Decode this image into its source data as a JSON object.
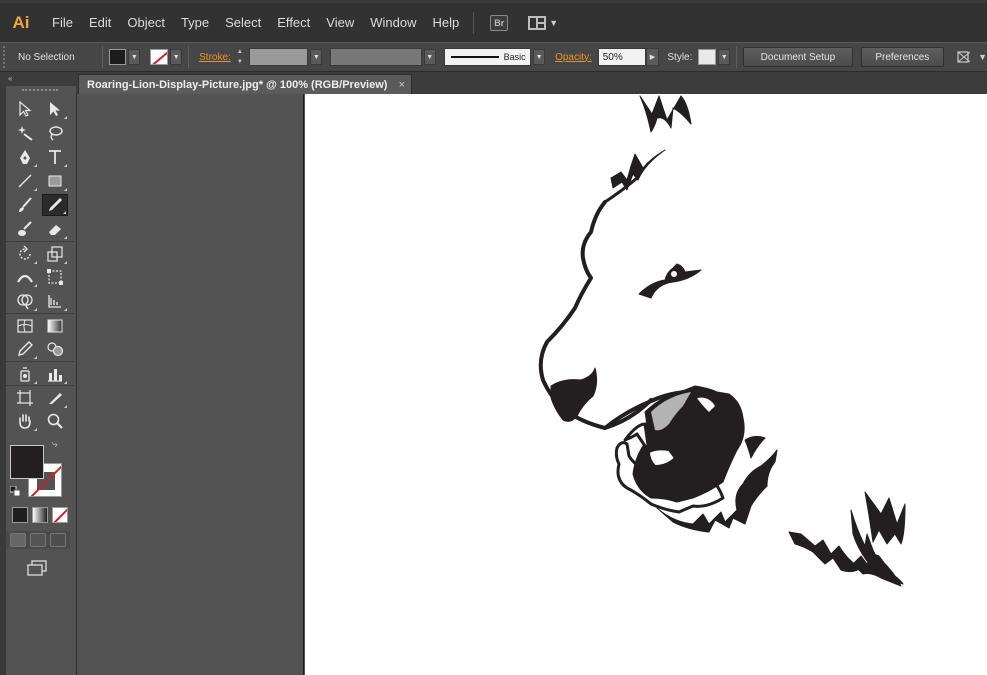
{
  "app": {
    "logo_text": "Ai"
  },
  "menu": {
    "items": [
      "File",
      "Edit",
      "Object",
      "Type",
      "Select",
      "Effect",
      "View",
      "Window",
      "Help"
    ],
    "bridge_label": "Br"
  },
  "control": {
    "selection_label": "No Selection",
    "stroke_label": "Stroke:",
    "profile_label": "Basic",
    "opacity_label": "Opacity:",
    "opacity_value": "50%",
    "style_label": "Style:",
    "document_setup": "Document Setup",
    "preferences": "Preferences"
  },
  "document": {
    "tab_title": "Roaring-Lion-Display-Picture.jpg* @ 100% (RGB/Preview)",
    "close_glyph": "×"
  },
  "toolbox": {
    "collapse_glyph": "«",
    "swap_glyph": "⤷"
  },
  "colors": {
    "fill": "#231f20",
    "accent_orange": "#e8932e",
    "none_red": "#d02020"
  }
}
